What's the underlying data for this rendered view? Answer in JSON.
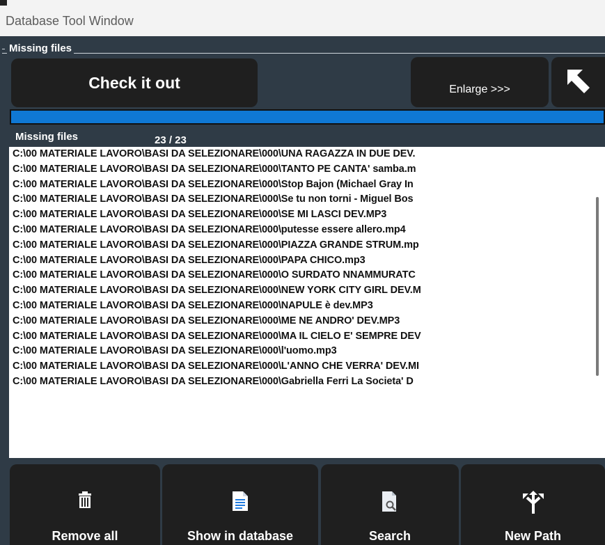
{
  "window": {
    "title": "Database Tool Window"
  },
  "group": {
    "title": "Missing files"
  },
  "toolbar": {
    "check_label": "Check it out",
    "enlarge_label": "Enlarge >>>",
    "back_icon": "back-arrow-icon"
  },
  "progress": {
    "value": 1.0,
    "color": "#0f78d4"
  },
  "list": {
    "header": "Missing files",
    "count": "23 / 23",
    "items": [
      "C:\\00 MATERIALE LAVORO\\BASI DA SELEZIONARE\\000\\UNA RAGAZZA IN DUE DEV.",
      "C:\\00 MATERIALE LAVORO\\BASI DA SELEZIONARE\\000\\TANTO PE CANTA'  samba.m",
      "C:\\00 MATERIALE LAVORO\\BASI DA SELEZIONARE\\000\\Stop Bajon (Michael Gray In",
      "C:\\00 MATERIALE LAVORO\\BASI DA SELEZIONARE\\000\\Se tu non torni - Miguel Bos",
      "C:\\00 MATERIALE LAVORO\\BASI DA SELEZIONARE\\000\\SE MI LASCI DEV.MP3",
      "C:\\00 MATERIALE LAVORO\\BASI DA SELEZIONARE\\000\\putesse essere allero.mp4",
      "C:\\00 MATERIALE LAVORO\\BASI DA SELEZIONARE\\000\\PIAZZA GRANDE STRUM.mp",
      "C:\\00 MATERIALE LAVORO\\BASI DA SELEZIONARE\\000\\PAPA CHICO.mp3",
      "C:\\00 MATERIALE LAVORO\\BASI DA SELEZIONARE\\000\\O SURDATO NNAMMURATC",
      "C:\\00 MATERIALE LAVORO\\BASI DA SELEZIONARE\\000\\NEW YORK CITY GIRL DEV.M",
      "C:\\00 MATERIALE LAVORO\\BASI DA SELEZIONARE\\000\\NAPULE è dev.MP3",
      "C:\\00 MATERIALE LAVORO\\BASI DA SELEZIONARE\\000\\ME NE ANDRO' DEV.MP3",
      "C:\\00 MATERIALE LAVORO\\BASI DA SELEZIONARE\\000\\MA IL CIELO E' SEMPRE DEV",
      "C:\\00 MATERIALE LAVORO\\BASI DA SELEZIONARE\\000\\l'uomo.mp3",
      "C:\\00 MATERIALE LAVORO\\BASI DA SELEZIONARE\\000\\L'ANNO CHE VERRA' DEV.MI",
      "C:\\00 MATERIALE LAVORO\\BASI DA SELEZIONARE\\000\\Gabriella Ferri   La Societa' D"
    ]
  },
  "actions": {
    "remove_all": {
      "label": "Remove all",
      "icon": "trash-icon"
    },
    "show_in_db": {
      "label": "Show in database",
      "icon": "document-icon"
    },
    "search": {
      "label": "Search",
      "icon": "file-search-icon"
    },
    "new_path": {
      "label": "New Path",
      "icon": "path-split-icon"
    }
  },
  "colors": {
    "panel": "#2f3b46",
    "button": "#1f1f1f",
    "accent": "#0f78d4"
  }
}
